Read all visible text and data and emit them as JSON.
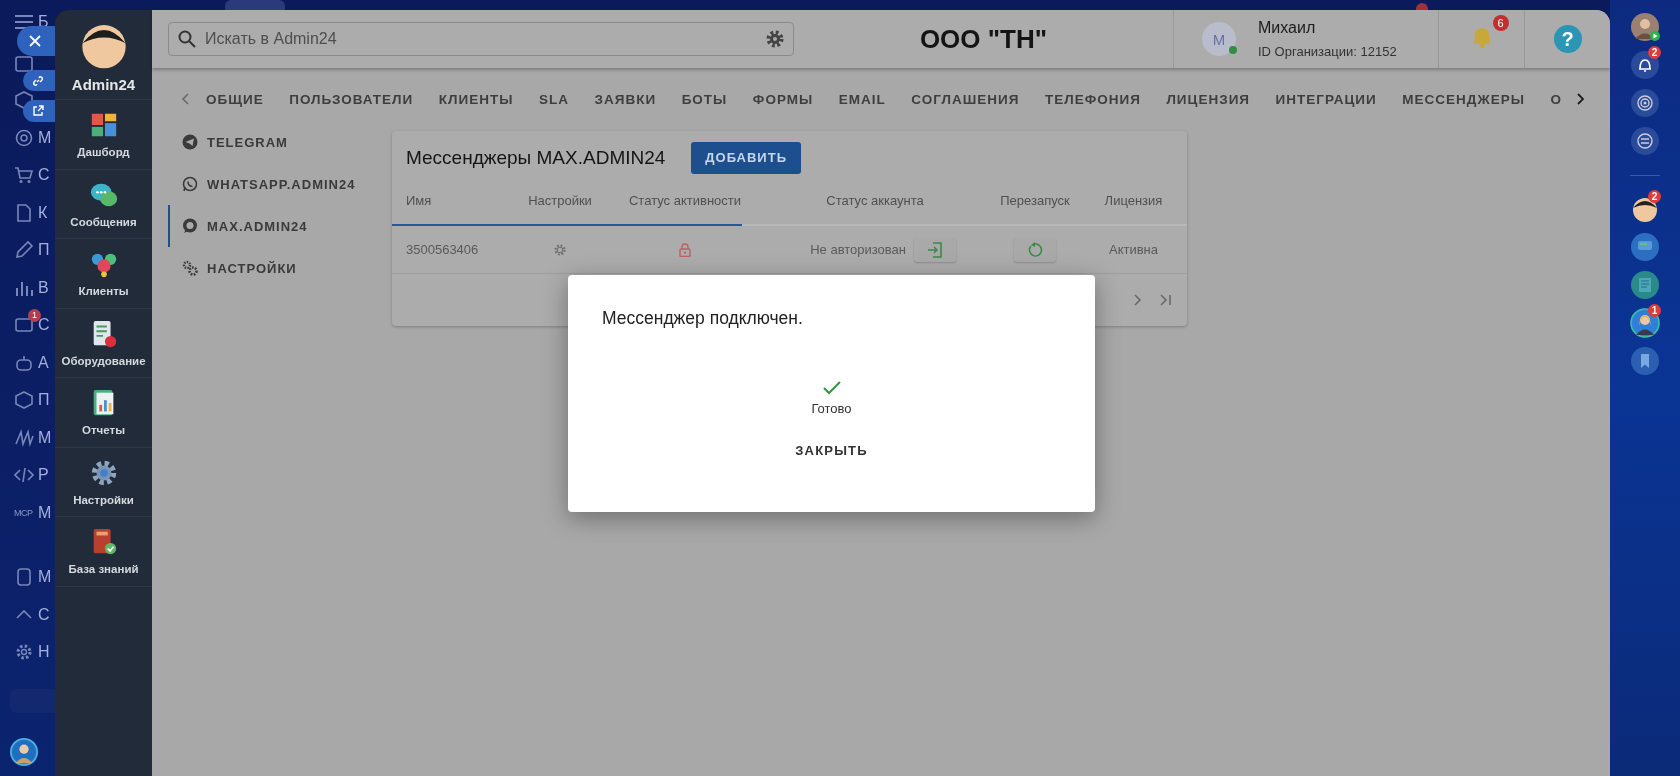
{
  "desktop_menu": {
    "header": "Б",
    "groups": [
      [
        {
          "kind": "calendar"
        },
        {
          "kind": "box"
        },
        {
          "kind": "target",
          "label": "М"
        },
        {
          "kind": "cart",
          "label": "С"
        },
        {
          "kind": "doc",
          "label": "К"
        },
        {
          "kind": "pen",
          "label": "П"
        },
        {
          "kind": "chart",
          "label": "В"
        },
        {
          "kind": "card",
          "label": "С",
          "badge": "1"
        },
        {
          "kind": "bot",
          "label": "А"
        },
        {
          "kind": "cube",
          "label": "П"
        },
        {
          "kind": "wave",
          "label": "М"
        },
        {
          "kind": "code",
          "label": "Р"
        },
        {
          "kind": "text",
          "icon_text": "MCP",
          "label": "М"
        }
      ],
      [
        {
          "kind": "phone",
          "label": "М"
        },
        {
          "kind": "chevron",
          "label": "С"
        },
        {
          "kind": "gear",
          "label": "Н"
        }
      ]
    ]
  },
  "nav": {
    "brand": "Admin24",
    "items": [
      {
        "kind": "dashboard",
        "label": "Дашборд"
      },
      {
        "kind": "messages",
        "label": "Сообщения"
      },
      {
        "kind": "clients",
        "label": "Клиенты"
      },
      {
        "kind": "equipment",
        "label": "Оборудование"
      },
      {
        "kind": "reports",
        "label": "Отчеты"
      },
      {
        "kind": "settings",
        "label": "Настройки"
      },
      {
        "kind": "knowledge",
        "label": "База знаний"
      }
    ]
  },
  "header": {
    "search": {
      "placeholder": "Искать в Admin24"
    },
    "company": "ООО \"ТН\"",
    "user": {
      "initial": "М",
      "online": true,
      "name": "Михаил",
      "org_id": "ID Организации: 12152"
    },
    "notifications": {
      "badge": "6"
    },
    "help": {
      "label": "?"
    }
  },
  "tabs": [
    {
      "label": "ОБЩИЕ"
    },
    {
      "label": "ПОЛЬЗОВАТЕЛИ"
    },
    {
      "label": "КЛИЕНТЫ"
    },
    {
      "label": "SLA"
    },
    {
      "label": "ЗАЯВКИ"
    },
    {
      "label": "БОТЫ"
    },
    {
      "label": "ФОРМЫ"
    },
    {
      "label": "EMAIL"
    },
    {
      "label": "СОГЛАШЕНИЯ"
    },
    {
      "label": "ТЕЛЕФОНИЯ"
    },
    {
      "label": "ЛИЦЕНЗИЯ"
    },
    {
      "label": "ИНТЕГРАЦИИ"
    },
    {
      "label": "МЕССЕНДЖЕРЫ"
    },
    {
      "label": "О"
    }
  ],
  "submenu": [
    {
      "kind": "telegram",
      "label": "TELEGRAM",
      "selected": false
    },
    {
      "kind": "whatsapp",
      "label": "WHATSAPP.ADMIN24",
      "selected": false
    },
    {
      "kind": "chat",
      "label": "MAX.ADMIN24",
      "selected": true
    },
    {
      "kind": "gears",
      "label": "НАСТРОЙКИ",
      "selected": false
    }
  ],
  "card": {
    "title": "Мессенджеры MAX.ADMIN24",
    "add_button": "ДОБАВИТЬ",
    "columns": [
      "Имя",
      "Настройки",
      "Статус активности",
      "Статус аккаунта",
      "Перезапуск",
      "Лицензия"
    ],
    "progress": {
      "level": 0.44
    },
    "rows": [
      {
        "name": "3500563406",
        "account_status": "Не авторизован",
        "license": "Активна"
      }
    ]
  },
  "dialog": {
    "title": "Мессенджер подключен.",
    "status": "Готово",
    "close_button": "ЗАКРЫТЬ"
  },
  "dock": [
    {
      "kind": "avatar"
    },
    {
      "kind": "bell",
      "badge": "2"
    },
    {
      "kind": "spiral"
    },
    {
      "kind": "swap"
    },
    {
      "kind": "separator"
    },
    {
      "kind": "mascot",
      "badge": "2"
    },
    {
      "kind": "chat"
    },
    {
      "kind": "news"
    },
    {
      "kind": "person",
      "badge": "1"
    },
    {
      "kind": "bookmark"
    }
  ]
}
